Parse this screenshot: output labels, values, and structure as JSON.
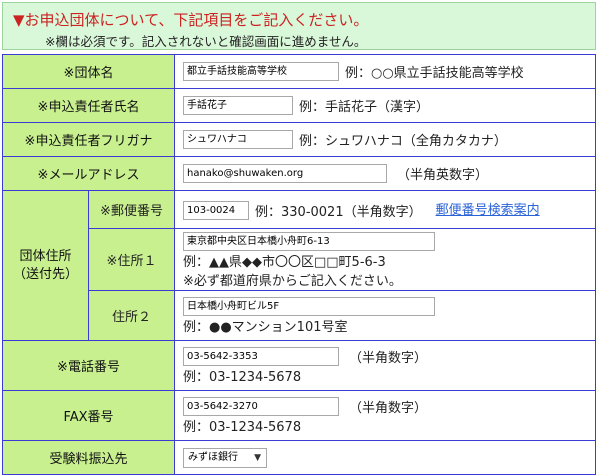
{
  "notice": {
    "line1": "▼お申込団体について、下記項目をご記入ください。",
    "line2": "※欄は必須です。記入されないと確認画面に進めません。"
  },
  "fields": {
    "org_name": {
      "label": "※団体名",
      "value": "都立手話技能高等学校",
      "example": "例：○○県立手話技能高等学校"
    },
    "person_name": {
      "label": "※申込責任者氏名",
      "value": "手話花子",
      "example": "例：手話花子（漢字）"
    },
    "person_kana": {
      "label": "※申込責任者フリガナ",
      "value": "シュワハナコ",
      "example": "例：シュワハナコ（全角カタカナ）"
    },
    "email": {
      "label": "※メールアドレス",
      "value": "hanako@shuwaken.org",
      "note": "（半角英数字）"
    },
    "address_group_label": "団体住所\n（送付先）",
    "postal": {
      "label": "※郵便番号",
      "value": "103-0024",
      "example": "例：330-0021（半角数字）",
      "link": "郵便番号検索案内"
    },
    "address1": {
      "label": "※住所１",
      "value": "東京都中央区日本橋小舟町6-13",
      "example": "例：▲▲県◆◆市〇〇区□□町5-6-3",
      "note": "※必ず都道府県からご記入ください。"
    },
    "address2": {
      "label": "住所２",
      "value": "日本橋小舟町ビル5F",
      "example": "例：●●マンション101号室"
    },
    "phone": {
      "label": "※電話番号",
      "value": "03-5642-3353",
      "note": "（半角数字）",
      "example": "例：03-1234-5678"
    },
    "fax": {
      "label": "FAX番号",
      "value": "03-5642-3270",
      "note": "（半角数字）",
      "example": "例：03-1234-5678"
    },
    "bank": {
      "label": "受験料振込先",
      "value": "みずほ銀行"
    }
  }
}
